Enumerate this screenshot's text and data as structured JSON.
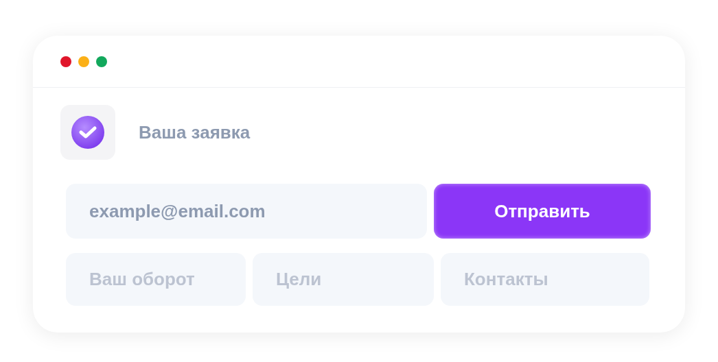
{
  "window": {
    "controls": [
      {
        "color": "#e0162b"
      },
      {
        "color": "#fbb017"
      },
      {
        "color": "#12a85c"
      }
    ]
  },
  "header": {
    "title": "Ваша заявка"
  },
  "email_field": {
    "value": "example@email.com"
  },
  "submit_button": {
    "label": "Отправить"
  },
  "fields": [
    {
      "placeholder": "Ваш оборот"
    },
    {
      "placeholder": "Цели"
    },
    {
      "placeholder": "Контакты"
    }
  ]
}
